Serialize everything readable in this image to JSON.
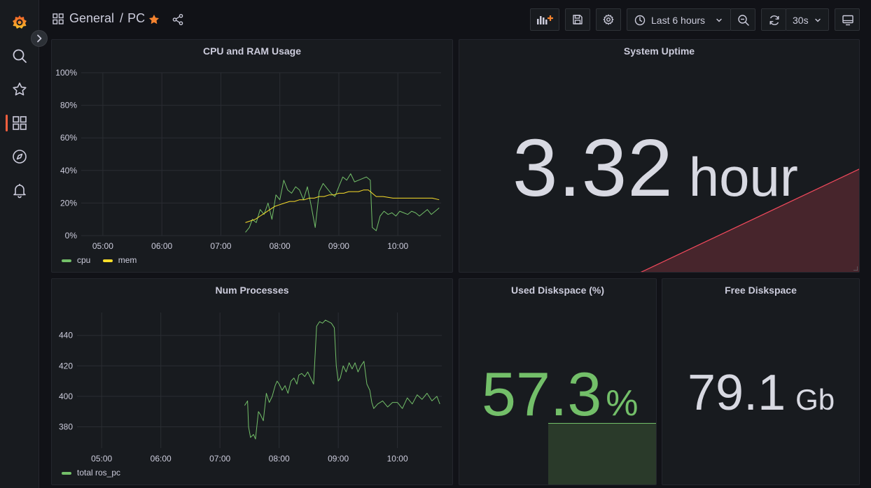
{
  "header": {
    "folder": "General",
    "separator": "/",
    "dashboard": "PC",
    "time_range": "Last 6 hours",
    "refresh_interval": "30s"
  },
  "colors": {
    "accent": "#f55f3e",
    "cpu": "#73bf69",
    "mem": "#fade2a",
    "uptime_area": "#f2495c",
    "disk_used": "#73bf69",
    "text": "#ccccdc",
    "big_text": "#d8d9e2"
  },
  "sidebar": {
    "items": [
      "grafana-logo",
      "search-icon",
      "starred-icon",
      "dashboards-icon",
      "explore-icon",
      "alerting-icon"
    ]
  },
  "panels": {
    "cpu_ram": {
      "title": "CPU and RAM Usage",
      "legend": [
        "cpu",
        "mem"
      ]
    },
    "uptime": {
      "title": "System Uptime",
      "value": "3.32",
      "unit": "hour"
    },
    "processes": {
      "title": "Num Processes",
      "legend": [
        "total ros_pc"
      ]
    },
    "used_disk": {
      "title": "Used Diskspace (%)",
      "value": "57.3",
      "unit": "%",
      "level": 0.573
    },
    "free_disk": {
      "title": "Free Diskspace",
      "value": "79.1",
      "unit": "Gb"
    }
  },
  "chart_data": [
    {
      "type": "line",
      "title": "CPU and RAM Usage",
      "x_ticks": [
        "05:00",
        "06:00",
        "07:00",
        "08:00",
        "09:00",
        "10:00"
      ],
      "y_ticks": [
        "0%",
        "20%",
        "40%",
        "60%",
        "80%",
        "100%"
      ],
      "ylim": [
        0,
        100
      ],
      "xlim": [
        "04:38",
        "10:44"
      ],
      "grid": true,
      "legend_position": "bottom-left",
      "series": [
        {
          "name": "cpu",
          "x": [
            "07:25",
            "07:29",
            "07:32",
            "07:36",
            "07:40",
            "07:44",
            "07:48",
            "07:52",
            "07:56",
            "08:00",
            "08:04",
            "08:08",
            "08:12",
            "08:16",
            "08:20",
            "08:24",
            "08:28",
            "08:32",
            "08:36",
            "08:40",
            "08:44",
            "08:48",
            "08:52",
            "08:56",
            "09:00",
            "09:04",
            "09:08",
            "09:12",
            "09:16",
            "09:20",
            "09:24",
            "09:28",
            "09:32",
            "09:34",
            "09:38",
            "09:42",
            "09:46",
            "09:50",
            "09:54",
            "09:58",
            "10:02",
            "10:06",
            "10:10",
            "10:14",
            "10:18",
            "10:22",
            "10:26",
            "10:30",
            "10:34",
            "10:38",
            "10:42"
          ],
          "values": [
            2,
            5,
            10,
            8,
            16,
            13,
            20,
            10,
            25,
            22,
            34,
            28,
            26,
            30,
            28,
            22,
            30,
            18,
            5,
            27,
            32,
            29,
            26,
            24,
            30,
            36,
            34,
            38,
            33,
            34,
            35,
            36,
            34,
            5,
            3,
            12,
            15,
            13,
            14,
            12,
            15,
            14,
            13,
            15,
            14,
            12,
            14,
            16,
            13,
            15,
            17
          ]
        },
        {
          "name": "mem",
          "x": [
            "07:25",
            "07:30",
            "07:35",
            "07:40",
            "07:45",
            "07:50",
            "07:55",
            "08:00",
            "08:05",
            "08:10",
            "08:15",
            "08:20",
            "08:25",
            "08:30",
            "08:35",
            "08:40",
            "08:45",
            "08:50",
            "08:55",
            "09:00",
            "09:05",
            "09:10",
            "09:15",
            "09:20",
            "09:25",
            "09:30",
            "09:34",
            "09:38",
            "09:45",
            "09:55",
            "10:05",
            "10:15",
            "10:25",
            "10:35",
            "10:42"
          ],
          "values": [
            8,
            9,
            10,
            12,
            14,
            16,
            18,
            19,
            20,
            21,
            21,
            22,
            22,
            23,
            23,
            24,
            24,
            25,
            25,
            26,
            26,
            27,
            27,
            27,
            28,
            28,
            26,
            24,
            24,
            23,
            23,
            23,
            23,
            23,
            22
          ]
        }
      ]
    },
    {
      "type": "line",
      "title": "Num Processes",
      "x_ticks": [
        "05:00",
        "06:00",
        "07:00",
        "08:00",
        "09:00",
        "10:00"
      ],
      "y_ticks": [
        "380",
        "400",
        "420",
        "440"
      ],
      "ylim": [
        366,
        455
      ],
      "xlim": [
        "04:35",
        "10:45"
      ],
      "grid": true,
      "legend_position": "bottom-left",
      "series": [
        {
          "name": "total ros_pc",
          "x": [
            "07:25",
            "07:28",
            "07:29",
            "07:31",
            "07:34",
            "07:36",
            "07:39",
            "07:41",
            "07:44",
            "07:47",
            "07:50",
            "07:53",
            "07:56",
            "07:58",
            "08:00",
            "08:03",
            "08:06",
            "08:09",
            "08:12",
            "08:15",
            "08:18",
            "08:20",
            "08:23",
            "08:26",
            "08:29",
            "08:32",
            "08:35",
            "08:38",
            "08:41",
            "08:44",
            "08:47",
            "08:50",
            "08:53",
            "08:56",
            "08:58",
            "09:00",
            "09:02",
            "09:05",
            "09:08",
            "09:11",
            "09:14",
            "09:17",
            "09:20",
            "09:23",
            "09:26",
            "09:29",
            "09:32",
            "09:34",
            "09:36",
            "09:40",
            "09:45",
            "09:50",
            "09:55",
            "10:00",
            "10:05",
            "10:10",
            "10:15",
            "10:20",
            "10:25",
            "10:30",
            "10:35",
            "10:40",
            "10:43"
          ],
          "values": [
            394,
            397,
            380,
            373,
            375,
            372,
            390,
            388,
            384,
            402,
            396,
            400,
            407,
            410,
            408,
            404,
            407,
            402,
            410,
            412,
            408,
            414,
            415,
            413,
            416,
            412,
            408,
            446,
            449,
            448,
            450,
            449,
            448,
            445,
            420,
            410,
            412,
            420,
            416,
            422,
            418,
            422,
            416,
            420,
            423,
            408,
            404,
            396,
            392,
            395,
            397,
            393,
            396,
            396,
            392,
            399,
            395,
            401,
            398,
            402,
            397,
            400,
            395
          ]
        }
      ]
    }
  ]
}
